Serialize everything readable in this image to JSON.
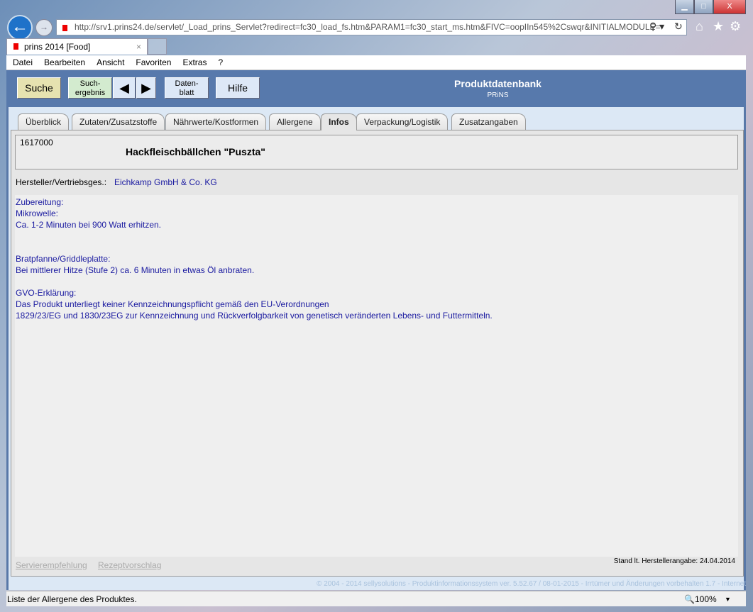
{
  "browser": {
    "url": "http://srv1.prins24.de/servlet/_Load_prins_Servlet?redirect=fc30_load_fs.htm&PARAM1=fc30_start_ms.htm&FIVC=oopIIn545%2Cswqr&INITIALMODULE=",
    "tab_title": "prins 2014 [Food]",
    "menu": [
      "Datei",
      "Bearbeiten",
      "Ansicht",
      "Favoriten",
      "Extras",
      "?"
    ],
    "status": "Liste der Allergene des Produktes.",
    "zoom": "100%"
  },
  "toolbar": {
    "search": "Suche",
    "results_line1": "Such-",
    "results_line2": "ergebnis",
    "sheet_line1": "Daten-",
    "sheet_line2": "blatt",
    "help": "Hilfe",
    "title": "Produktdatenbank",
    "subtitle": "PRiNS"
  },
  "tabs": [
    "Überblick",
    "Zutaten/Zusatzstoffe",
    "Nährwerte/Kostformen",
    "Allergene",
    "Infos",
    "Verpackung/Logistik",
    "Zusatzangaben"
  ],
  "product": {
    "id": "1617000",
    "name": "Hackfleischbällchen \"Puszta\"",
    "manufacturer_label": "Hersteller/Vertriebsges.:",
    "manufacturer": "Eichkamp GmbH & Co. KG"
  },
  "info_lines": [
    "Zubereitung:",
    "Mikrowelle:",
    "Ca. 1-2 Minuten bei 900 Watt erhitzen.",
    "",
    "",
    "Bratpfanne/Griddleplatte:",
    "Bei mittlerer Hitze (Stufe 2) ca. 6 Minuten in etwas Öl anbraten.",
    "",
    "GVO-Erklärung:",
    "Das Produkt unterliegt keiner Kennzeichnungspflicht gemäß den EU-Verordnungen",
    "1829/23/EG und 1830/23EG zur Kennzeichnung und Rückverfolgbarkeit von genetisch veränderten Lebens- und Futtermitteln."
  ],
  "footer": {
    "link1": "Servierempfehlung",
    "link2": "Rezeptvorschlag",
    "stand": "Stand lt. Herstellerangabe: 24.04.2014",
    "copyright": "© 2004 - 2014 sellysolutions - Produktinformationssystem ver. 5.52.67 / 08-01-2015 - Irrtümer und Änderungen vorbehalten  1.7 - Internet"
  }
}
